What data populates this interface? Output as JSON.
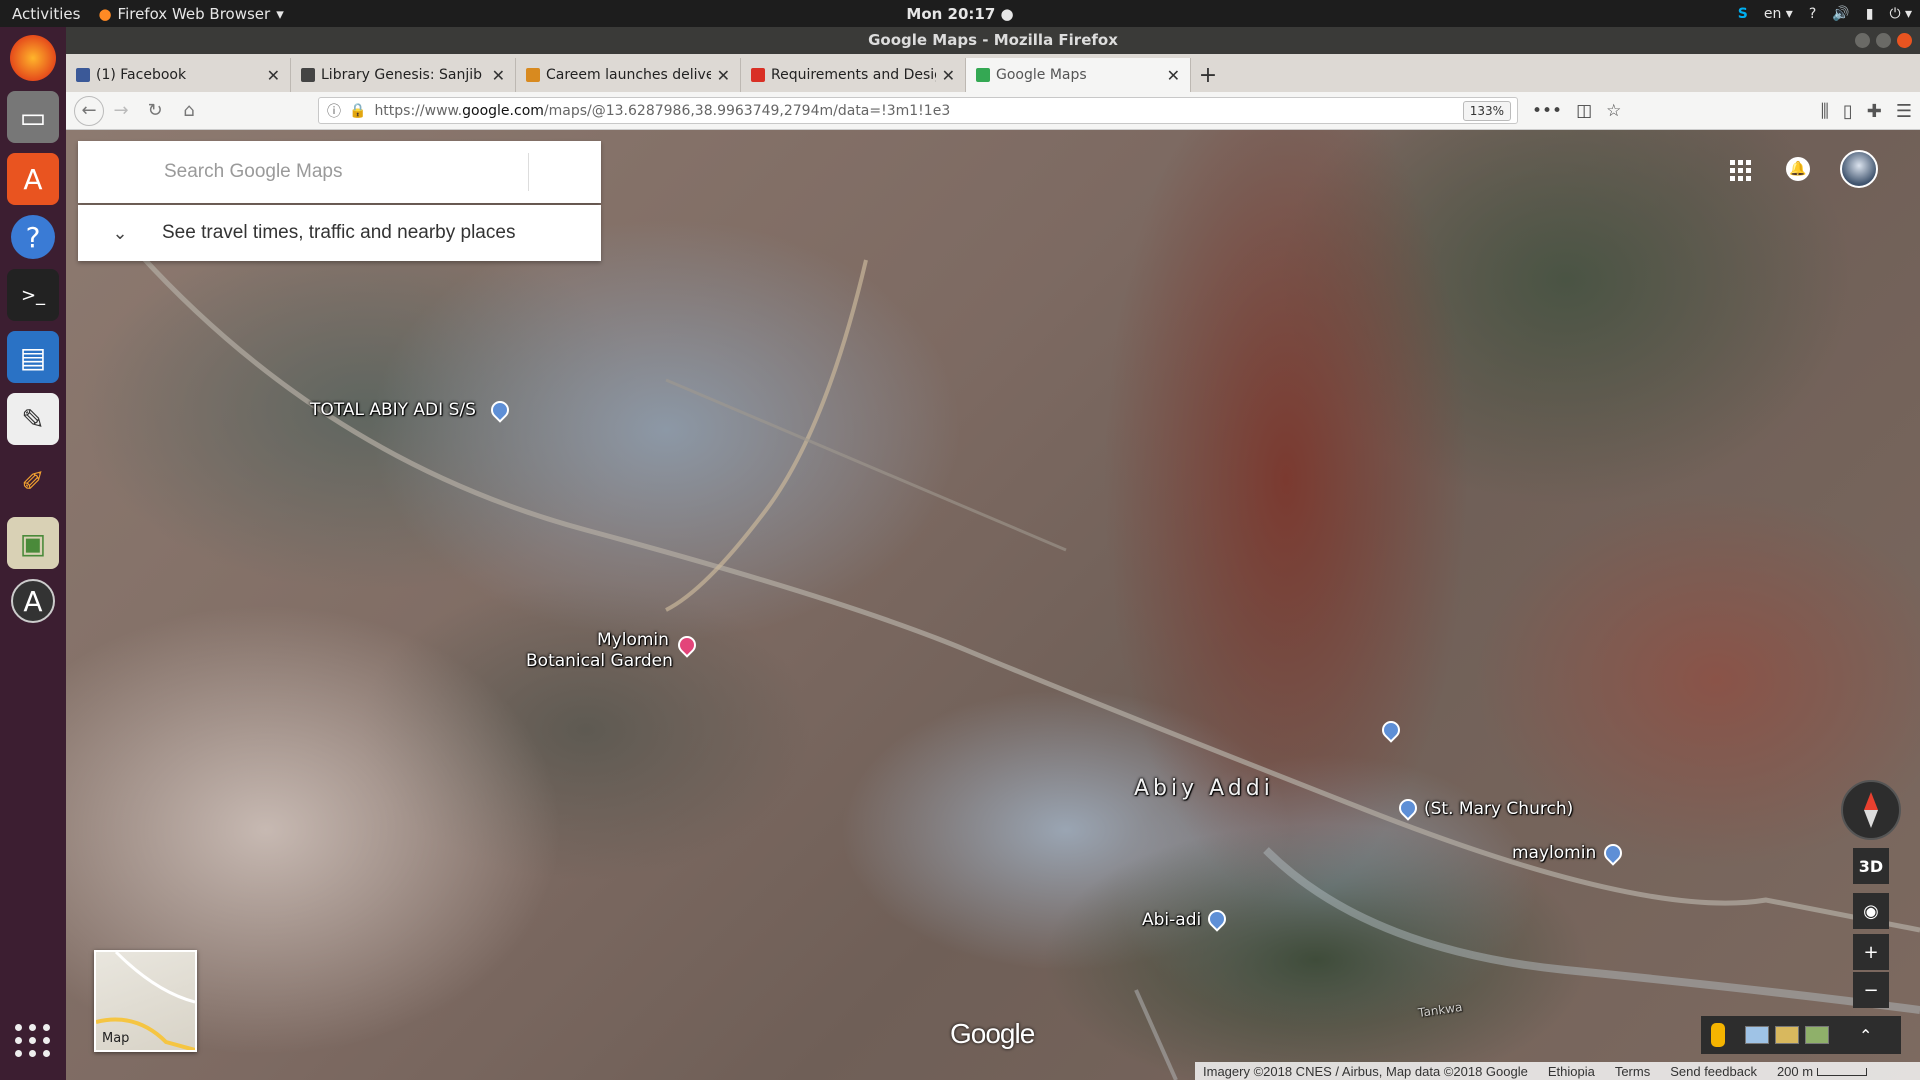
{
  "topbar": {
    "activities": "Activities",
    "app_menu": "Firefox Web Browser",
    "clock": "Mon 20:17 ●",
    "lang": "en",
    "help": "?"
  },
  "window": {
    "title": "Google Maps - Mozilla Firefox"
  },
  "tabs": [
    {
      "title": "(1) Facebook",
      "color": "#3b5998"
    },
    {
      "title": "Library Genesis: Sanjib S",
      "color": "#444444"
    },
    {
      "title": "Careem launches deliver",
      "color": "#d88a1f"
    },
    {
      "title": "Requirements and Desig",
      "color": "#d93025"
    },
    {
      "title": "Google Maps",
      "color": "#34a853"
    }
  ],
  "url": {
    "prefix": "https://www.",
    "domain": "google.com",
    "path": "/maps/@13.6287986,38.9963749,2794m/data=!3m1!1e3",
    "zoom": "133%"
  },
  "search": {
    "placeholder": "Search Google Maps",
    "travel": "See travel times, traffic and nearby places"
  },
  "map_labels": {
    "total": "TOTAL ABIY ADI S/S",
    "garden_line1": "Mylomin",
    "garden_line2": "Botanical Garden",
    "town": "Abiy Addi",
    "church": "(St. Mary Church)",
    "maylomin": "maylomin",
    "abi_adi": "Abi-adi",
    "tankwa": "Tankwa"
  },
  "controls": {
    "three_d": "3D",
    "zoom_in": "+",
    "zoom_out": "−",
    "minimap_label": "Map",
    "logo": "Google"
  },
  "footer": {
    "imagery": "Imagery ©2018 CNES / Airbus, Map data ©2018 Google",
    "country": "Ethiopia",
    "terms": "Terms",
    "feedback": "Send feedback",
    "scale": "200 m"
  },
  "colors": {
    "ubuntu_orange": "#e95420",
    "launcher_bg": "#3c1e31",
    "pin_blue": "#5e8fd6",
    "pin_pink": "#e3457a"
  }
}
